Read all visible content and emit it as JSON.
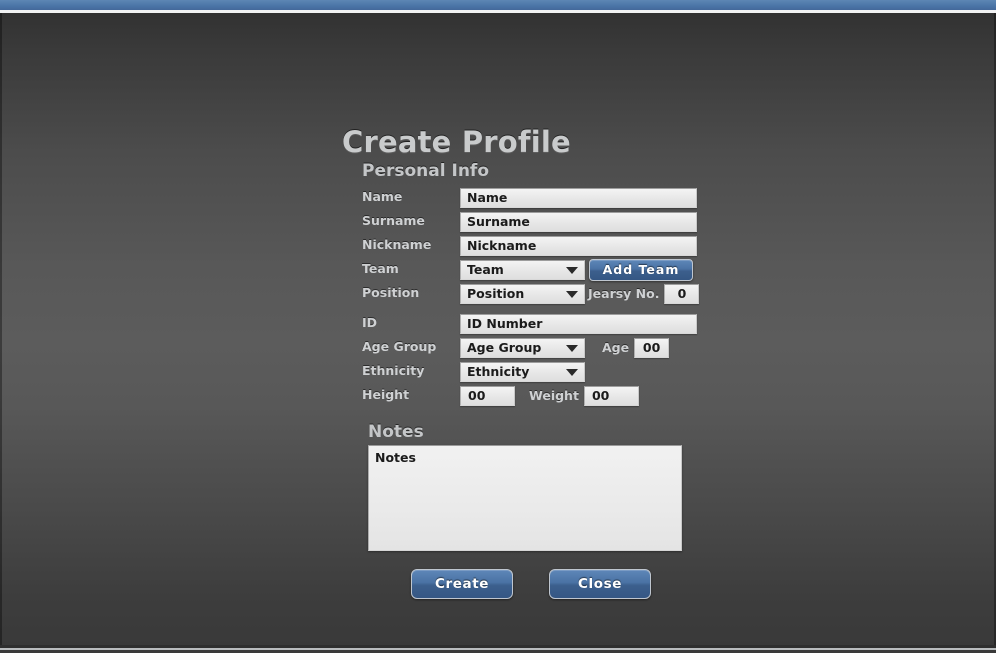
{
  "window": {
    "titlebar_color": "#4a74a6",
    "accent_color": "#4a72a4",
    "background_color": "#555555"
  },
  "dialog": {
    "title": "Create Profile",
    "section_title": "Personal Info",
    "fields": {
      "name": {
        "label": "Name",
        "value": "Name"
      },
      "surname": {
        "label": "Surname",
        "value": "Surname"
      },
      "nickname": {
        "label": "Nickname",
        "value": "Nickname"
      },
      "team": {
        "label": "Team",
        "value": "Team"
      },
      "add_team_button": "Add Team",
      "position": {
        "label": "Position",
        "value": "Position"
      },
      "jearsy_no": {
        "label": "Jearsy No.",
        "value": "0"
      },
      "id": {
        "label": "ID",
        "value": "ID Number"
      },
      "age_group": {
        "label": "Age Group",
        "value": "Age Group"
      },
      "age": {
        "label": "Age",
        "value": "00"
      },
      "ethnicity": {
        "label": "Ethnicity",
        "value": "Ethnicity"
      },
      "height": {
        "label": "Height",
        "value": "00"
      },
      "weight": {
        "label": "Weight",
        "value": "00"
      }
    },
    "notes": {
      "title": "Notes",
      "value": "Notes"
    },
    "footer": {
      "create_label": "Create",
      "close_label": "Close"
    }
  }
}
